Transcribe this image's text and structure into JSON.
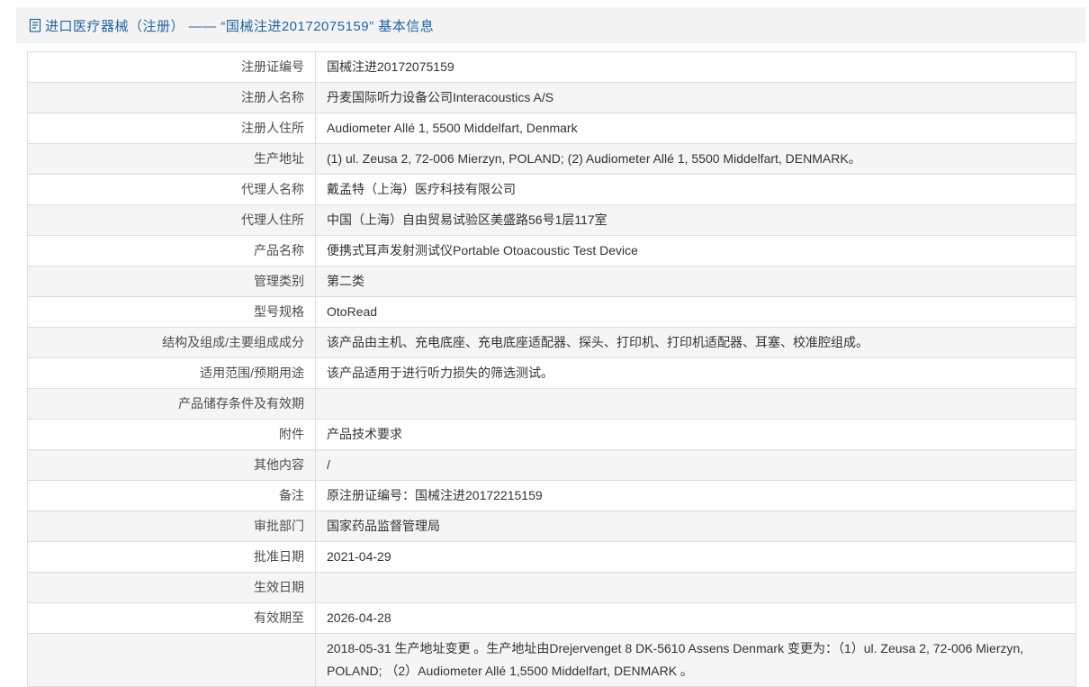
{
  "header": {
    "icon": "document-icon",
    "title": "进口医疗器械（注册） —— “国械注进20172075159” 基本信息"
  },
  "colors": {
    "title_blue": "#2166a5",
    "header_band_bg": "#f3f3f3",
    "table_border": "#dddddd",
    "zebra_row_bg": "#f5f5f5",
    "label_text": "#4d4d4d",
    "value_text": "#333333"
  },
  "table": {
    "rows": [
      {
        "label": "注册证编号",
        "value": "国械注进20172075159"
      },
      {
        "label": "注册人名称",
        "value": "丹麦国际听力设备公司Interacoustics A/S"
      },
      {
        "label": "注册人住所",
        "value": "Audiometer Allé 1, 5500 Middelfart, Denmark"
      },
      {
        "label": "生产地址",
        "value": "(1) ul. Zeusa 2, 72-006 Mierzyn, POLAND; (2) Audiometer Allé 1, 5500 Middelfart, DENMARK。"
      },
      {
        "label": "代理人名称",
        "value": "戴孟特（上海）医疗科技有限公司"
      },
      {
        "label": "代理人住所",
        "value": "中国（上海）自由贸易试验区美盛路56号1层117室"
      },
      {
        "label": "产品名称",
        "value": "便携式耳声发射测试仪Portable Otoacoustic Test Device"
      },
      {
        "label": "管理类别",
        "value": "第二类"
      },
      {
        "label": "型号规格",
        "value": "OtoRead"
      },
      {
        "label": "结构及组成/主要组成成分",
        "value": "该产品由主机、充电底座、充电底座适配器、探头、打印机、打印机适配器、耳塞、校准腔组成。"
      },
      {
        "label": "适用范围/预期用途",
        "value": "该产品适用于进行听力损失的筛选测试。"
      },
      {
        "label": "产品储存条件及有效期",
        "value": ""
      },
      {
        "label": "附件",
        "value": "产品技术要求"
      },
      {
        "label": "其他内容",
        "value": "/"
      },
      {
        "label": "备注",
        "value": "原注册证编号：国械注进20172215159"
      },
      {
        "label": "审批部门",
        "value": "国家药品监督管理局"
      },
      {
        "label": "批准日期",
        "value": "2021-04-29"
      },
      {
        "label": "生效日期",
        "value": ""
      },
      {
        "label": "有效期至",
        "value": "2026-04-28"
      },
      {
        "label": "",
        "value": "2018-05-31 生产地址变更 。生产地址由Drejervenget 8 DK-5610 Assens Denmark 变更为：（1）ul. Zeusa 2, 72-006 Mierzyn, POLAND; （2）Audiometer Allé 1,5500 Middelfart, DENMARK 。"
      }
    ]
  }
}
